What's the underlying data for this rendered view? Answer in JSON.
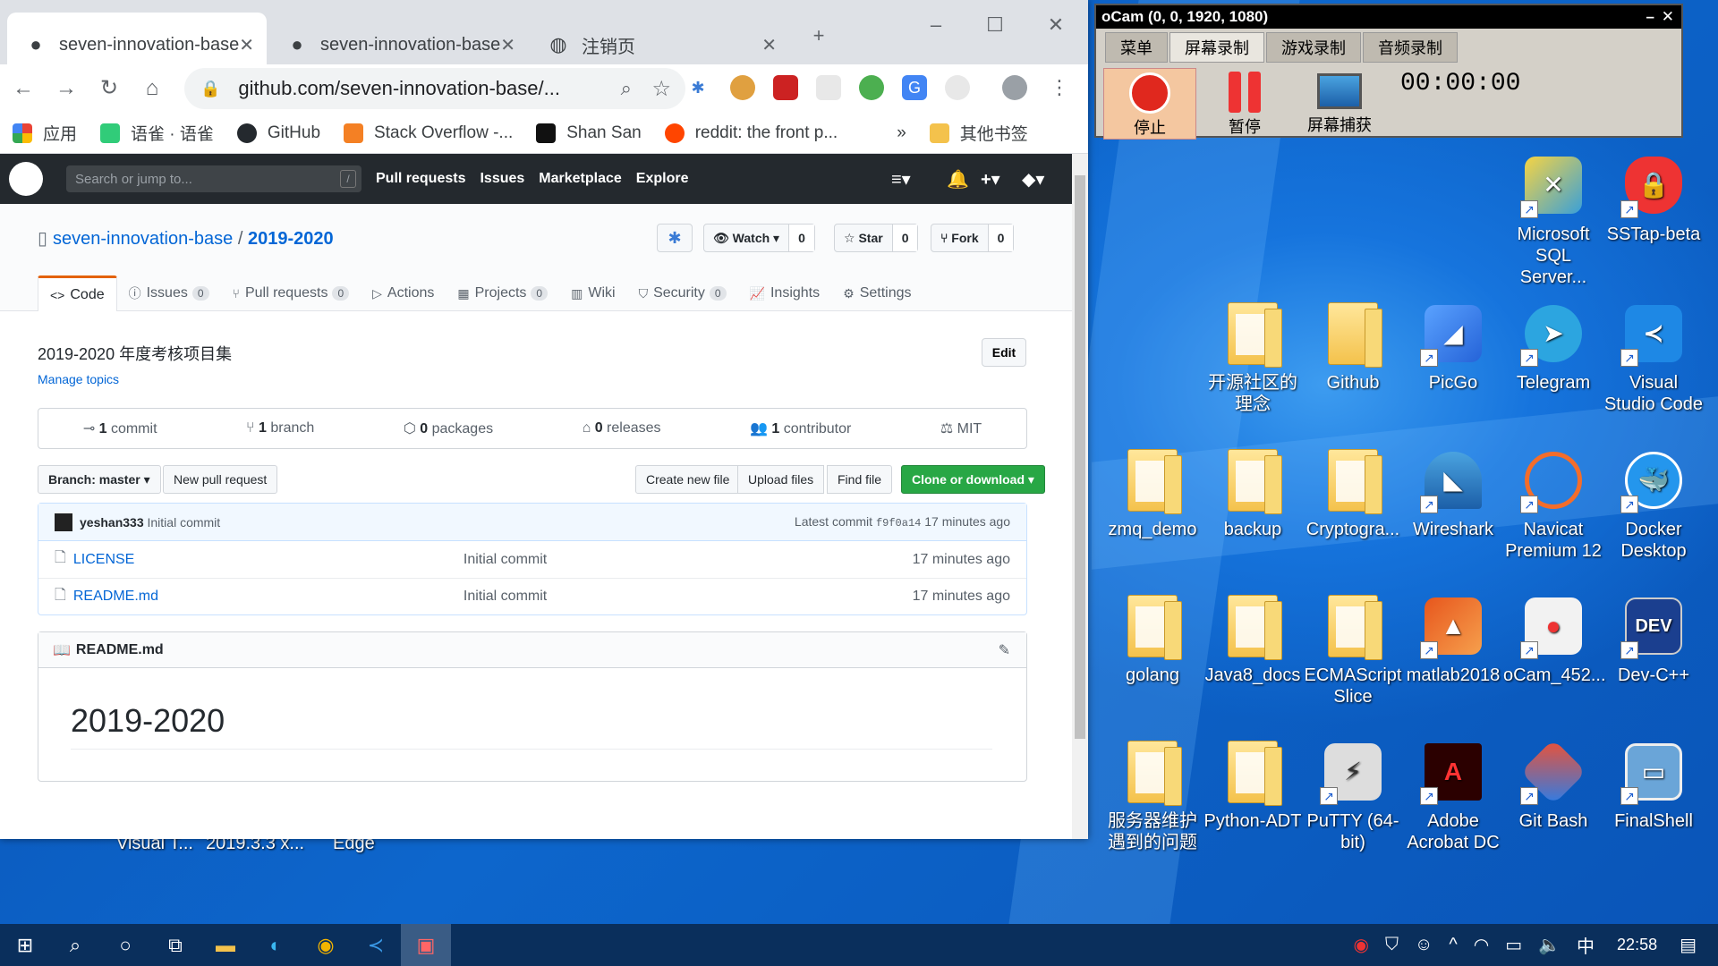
{
  "browser": {
    "tabs": [
      {
        "label": "seven-innovation-base"
      },
      {
        "label": "seven-innovation-base"
      },
      {
        "label": "注销页"
      }
    ],
    "url": "github.com/seven-innovation-base/...",
    "bookmarks": [
      "应用",
      "语雀 · 语雀",
      "GitHub",
      "Stack Overflow -...",
      "Shan San",
      "reddit: the front p...",
      "其他书签"
    ],
    "more": "»"
  },
  "github": {
    "search_placeholder": "Search or jump to...",
    "slash": "/",
    "nav": [
      "Pull requests",
      "Issues",
      "Marketplace",
      "Explore"
    ],
    "owner": "seven-innovation-base",
    "sep": "/",
    "repo": "2019-2020",
    "watch": {
      "label": "Watch",
      "count": "0"
    },
    "star": {
      "label": "Star",
      "count": "0"
    },
    "fork": {
      "label": "Fork",
      "count": "0"
    },
    "tabs": [
      {
        "label": "Code"
      },
      {
        "label": "Issues",
        "count": "0"
      },
      {
        "label": "Pull requests",
        "count": "0"
      },
      {
        "label": "Actions"
      },
      {
        "label": "Projects",
        "count": "0"
      },
      {
        "label": "Wiki"
      },
      {
        "label": "Security",
        "count": "0"
      },
      {
        "label": "Insights"
      },
      {
        "label": "Settings"
      }
    ],
    "description": "2019-2020 年度考核项目集",
    "manage_topics": "Manage topics",
    "edit": "Edit",
    "summary": {
      "commits": "1",
      "commits_label": "commit",
      "branches": "1",
      "branches_label": "branch",
      "packages": "0",
      "packages_label": "packages",
      "releases": "0",
      "releases_label": "releases",
      "contributors": "1",
      "contributors_label": "contributor",
      "license": "MIT"
    },
    "branch": "Branch: master",
    "new_pr": "New pull request",
    "create_file": "Create new file",
    "upload": "Upload files",
    "find": "Find file",
    "clone": "Clone or download",
    "commit": {
      "author": "yeshan333",
      "message": "Initial commit",
      "latest_label": "Latest commit",
      "hash": "f9f0a14",
      "time": "17 minutes ago"
    },
    "files": [
      {
        "name": "LICENSE",
        "message": "Initial commit",
        "time": "17 minutes ago"
      },
      {
        "name": "README.md",
        "message": "Initial commit",
        "time": "17 minutes ago"
      }
    ],
    "readme_title": "README.md",
    "readme_h1": "2019-2020"
  },
  "ocam": {
    "title": "oCam (0, 0, 1920, 1080)",
    "tabs": [
      "菜单",
      "屏幕录制",
      "游戏录制",
      "音频录制"
    ],
    "buttons": [
      "停止",
      "暂停",
      "屏幕捕获"
    ],
    "time": "00:00:00"
  },
  "desktop_icons": [
    "Microsoft SQL Server...",
    "SSTap-beta",
    "开源社区的理念",
    "Github",
    "PicGo",
    "Telegram",
    "Visual Studio Code",
    "zmq_demo",
    "backup",
    "Cryptogra...",
    "Wireshark",
    "Navicat Premium 12",
    "Docker Desktop",
    "golang",
    "Java8_docs",
    "ECMAScript Slice",
    "matlab2018",
    "oCam_452...",
    "Dev-C++",
    "服务器维护遇到的问题",
    "Python-ADT",
    "PuTTY (64-bit)",
    "Adobe Acrobat DC",
    "Git Bash",
    "FinalShell"
  ],
  "behind_window_labels": [
    "Visual T...",
    "2019.3.3 x...",
    "Edge"
  ],
  "taskbar": {
    "time": "22:58",
    "ime": "中"
  },
  "colors": {
    "github_header": "#24292e",
    "clone_green": "#28a745",
    "link": "#0366d6",
    "desktop": "#0a5fc4",
    "ocam_stop": "#e0281e"
  }
}
